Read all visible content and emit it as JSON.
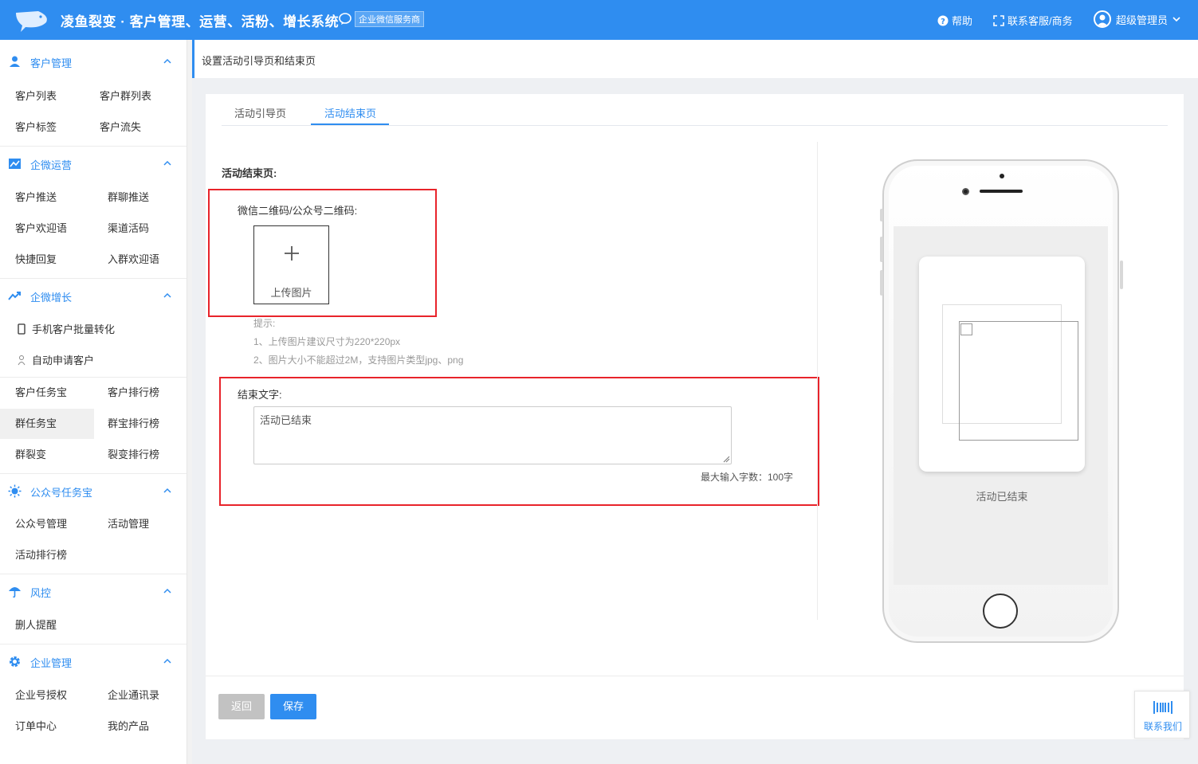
{
  "header": {
    "title": "凌鱼裂变 · 客户管理、运营、活粉、增长系统",
    "partner_badge": "企业微信服务商",
    "help": "帮助",
    "contact": "联系客服/商务",
    "user": "超级管理员"
  },
  "sidebar": {
    "groups": [
      {
        "label": "客户管理",
        "icon": "user-icon",
        "items": [
          "客户列表",
          "客户群列表",
          "客户标签",
          "客户流失"
        ]
      },
      {
        "label": "企微运营",
        "icon": "chart-icon",
        "items": [
          "客户推送",
          "群聊推送",
          "客户欢迎语",
          "渠道活码",
          "快捷回复",
          "入群欢迎语"
        ]
      },
      {
        "label": "企微增长",
        "icon": "trend-icon",
        "items": [
          "手机客户批量转化",
          "自动申请客户",
          "客户任务宝",
          "客户排行榜",
          "群任务宝",
          "群宝排行榜",
          "群裂变",
          "裂变排行榜"
        ]
      },
      {
        "label": "公众号任务宝",
        "icon": "sun-icon",
        "items": [
          "公众号管理",
          "活动管理",
          "活动排行榜"
        ]
      },
      {
        "label": "风控",
        "icon": "umbrella-icon",
        "items": [
          "删人提醒"
        ]
      },
      {
        "label": "企业管理",
        "icon": "gear-icon",
        "items": [
          "企业号授权",
          "企业通讯录",
          "订单中心",
          "我的产品"
        ]
      }
    ],
    "active_item": "群任务宝"
  },
  "breadcrumb": "设置活动引导页和结束页",
  "tabs": [
    "活动引导页",
    "活动结束页"
  ],
  "active_tab": "活动结束页",
  "form": {
    "section_title": "活动结束页:",
    "qr_label": "微信二维码/公众号二维码:",
    "upload_text": "上传图片",
    "hint_title": "提示:",
    "hint_1": "1、上传图片建议尺寸为220*220px",
    "hint_2": "2、图片大小不能超过2M，支持图片类型jpg、png",
    "end_text_label": "结束文字:",
    "end_text_value": "活动已结束",
    "max_chars": "最大输入字数：100字"
  },
  "preview": {
    "caption": "活动已结束"
  },
  "buttons": {
    "back": "返回",
    "save": "保存"
  },
  "contact_us": "联系我们",
  "colors": {
    "primary": "#2f8df0",
    "highlight_box": "#e8242b"
  }
}
